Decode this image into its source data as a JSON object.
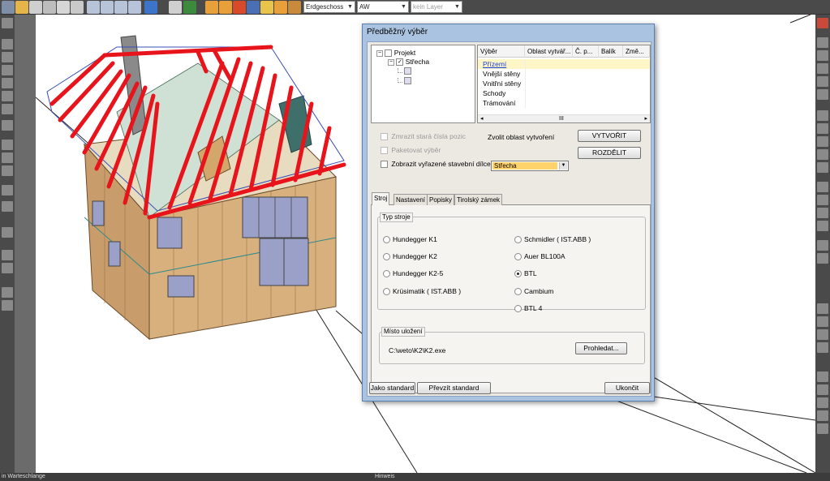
{
  "toolbar": {
    "floor_combo": "Erdgeschoss",
    "wall_combo": "AW",
    "layer_combo": "kein Layer",
    "icons": [
      "select-arrow-icon",
      "open-folder-icon",
      "save-icon",
      "save-as-icon",
      "print-icon",
      "print-preview-icon",
      "zoom-in-icon",
      "zoom-out-icon",
      "zoom-window-icon",
      "zoom-fit-icon",
      "undo-icon",
      "pan-icon",
      "cube-3d-icon",
      "snap-icon",
      "roof-tool-icon",
      "dimension-icon",
      "hatch-icon",
      "pointer-icon",
      "layers-icon"
    ]
  },
  "status": {
    "left_text": "in Warteschlange",
    "center_text": "Hinweis"
  },
  "dialog": {
    "title": "Předběžný výběr",
    "tree": {
      "items": [
        {
          "label": "Projekt",
          "expander": "−",
          "check": ""
        },
        {
          "label": "Střecha",
          "expander": "−",
          "check": "✓"
        }
      ]
    },
    "grid": {
      "columns": [
        "Výběr",
        "Oblast vytvář...",
        "Č. p...",
        "Balík",
        "Změ..."
      ],
      "rows": [
        "Přízemí",
        "Vnější stěny",
        "Vnitřní stěny",
        "Schody",
        "Trámování"
      ],
      "scroll_marker": "III"
    },
    "options": {
      "freeze_numbers": "Zmrazit stará čísla pozic",
      "packet_selection": "Paketovat výběr",
      "show_excluded": "Zobrazit vyřazené stavební dílce"
    },
    "area_label": "Zvolit oblast vytvoření",
    "area_value": "Střecha",
    "create_button": "VYTVOŘIT",
    "split_button": "ROZDĚLIT",
    "tabs": [
      "Stroj",
      "Nastavení",
      "Popisky",
      "Tirolský zámek"
    ],
    "machine_group": "Typ stroje",
    "machines_left": [
      "Hundegger K1",
      "Hundegger K2",
      "Hundegger K2-5",
      "Krüsimatik ( IST.ABB )"
    ],
    "machines_right": [
      "Schmidler ( IST.ABB )",
      "Auer BL100A",
      "BTL",
      "Cambium",
      "BTL 4"
    ],
    "selected_machine": "BTL",
    "storage_group": "Místo uložení",
    "storage_path": "C:\\weto\\K2\\K2.exe",
    "browse_button": "Prohledat...",
    "as_standard_button": "Jako standard",
    "take_standard_button": "Převzít standard",
    "close_button": "Ukončit"
  },
  "colors": {
    "roof_rafters": "#e8141c",
    "wall_wood": "#d8b07e",
    "dialog_frame": "#aac3e0",
    "dialog_body": "#ece9e2"
  }
}
